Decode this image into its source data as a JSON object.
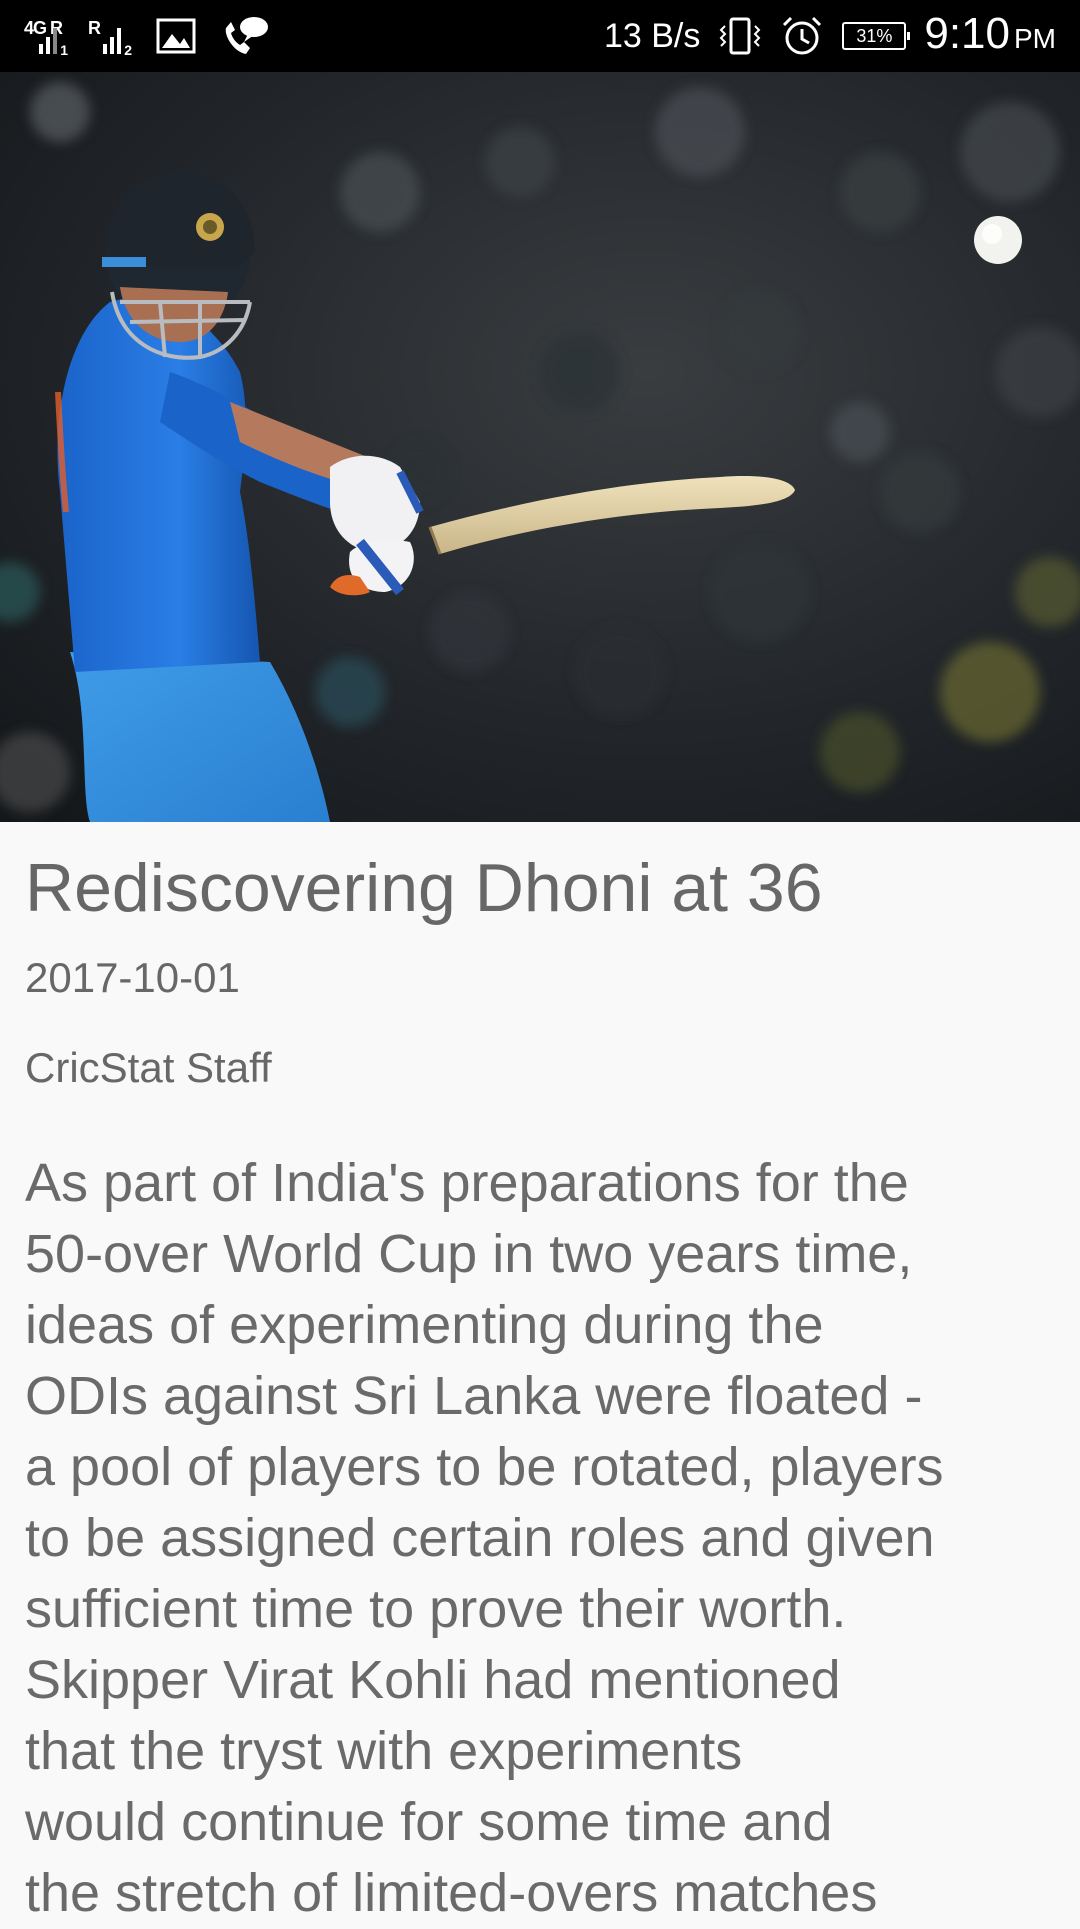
{
  "status_bar": {
    "sim1_tag": "4G R",
    "sim1_slot": "1",
    "sim2_tag": "R",
    "sim2_slot": "2",
    "net_speed": "13 B/s",
    "battery": "31%",
    "time": "9:10",
    "ampm": "PM",
    "icons": [
      "signal-icon",
      "signal-icon",
      "image-icon",
      "voip-call-icon",
      "vibrate-icon",
      "alarm-icon",
      "battery-icon"
    ]
  },
  "hero": {
    "image": "cricket-batsman-photo"
  },
  "article": {
    "title": "Rediscovering Dhoni at 36",
    "date": "2017-10-01",
    "author": "CricStat Staff",
    "body": "As part of India's preparations for the\n50-over World Cup in two years time,\nideas of experimenting during the\nODIs against Sri Lanka were floated -\na pool of players to be rotated, players\nto be assigned certain roles and given\nsufficient time to prove their worth.\nSkipper Virat Kohli had mentioned\nthat the tryst with experiments\nwould continue for some time and\nthe stretch of limited-overs matches"
  }
}
